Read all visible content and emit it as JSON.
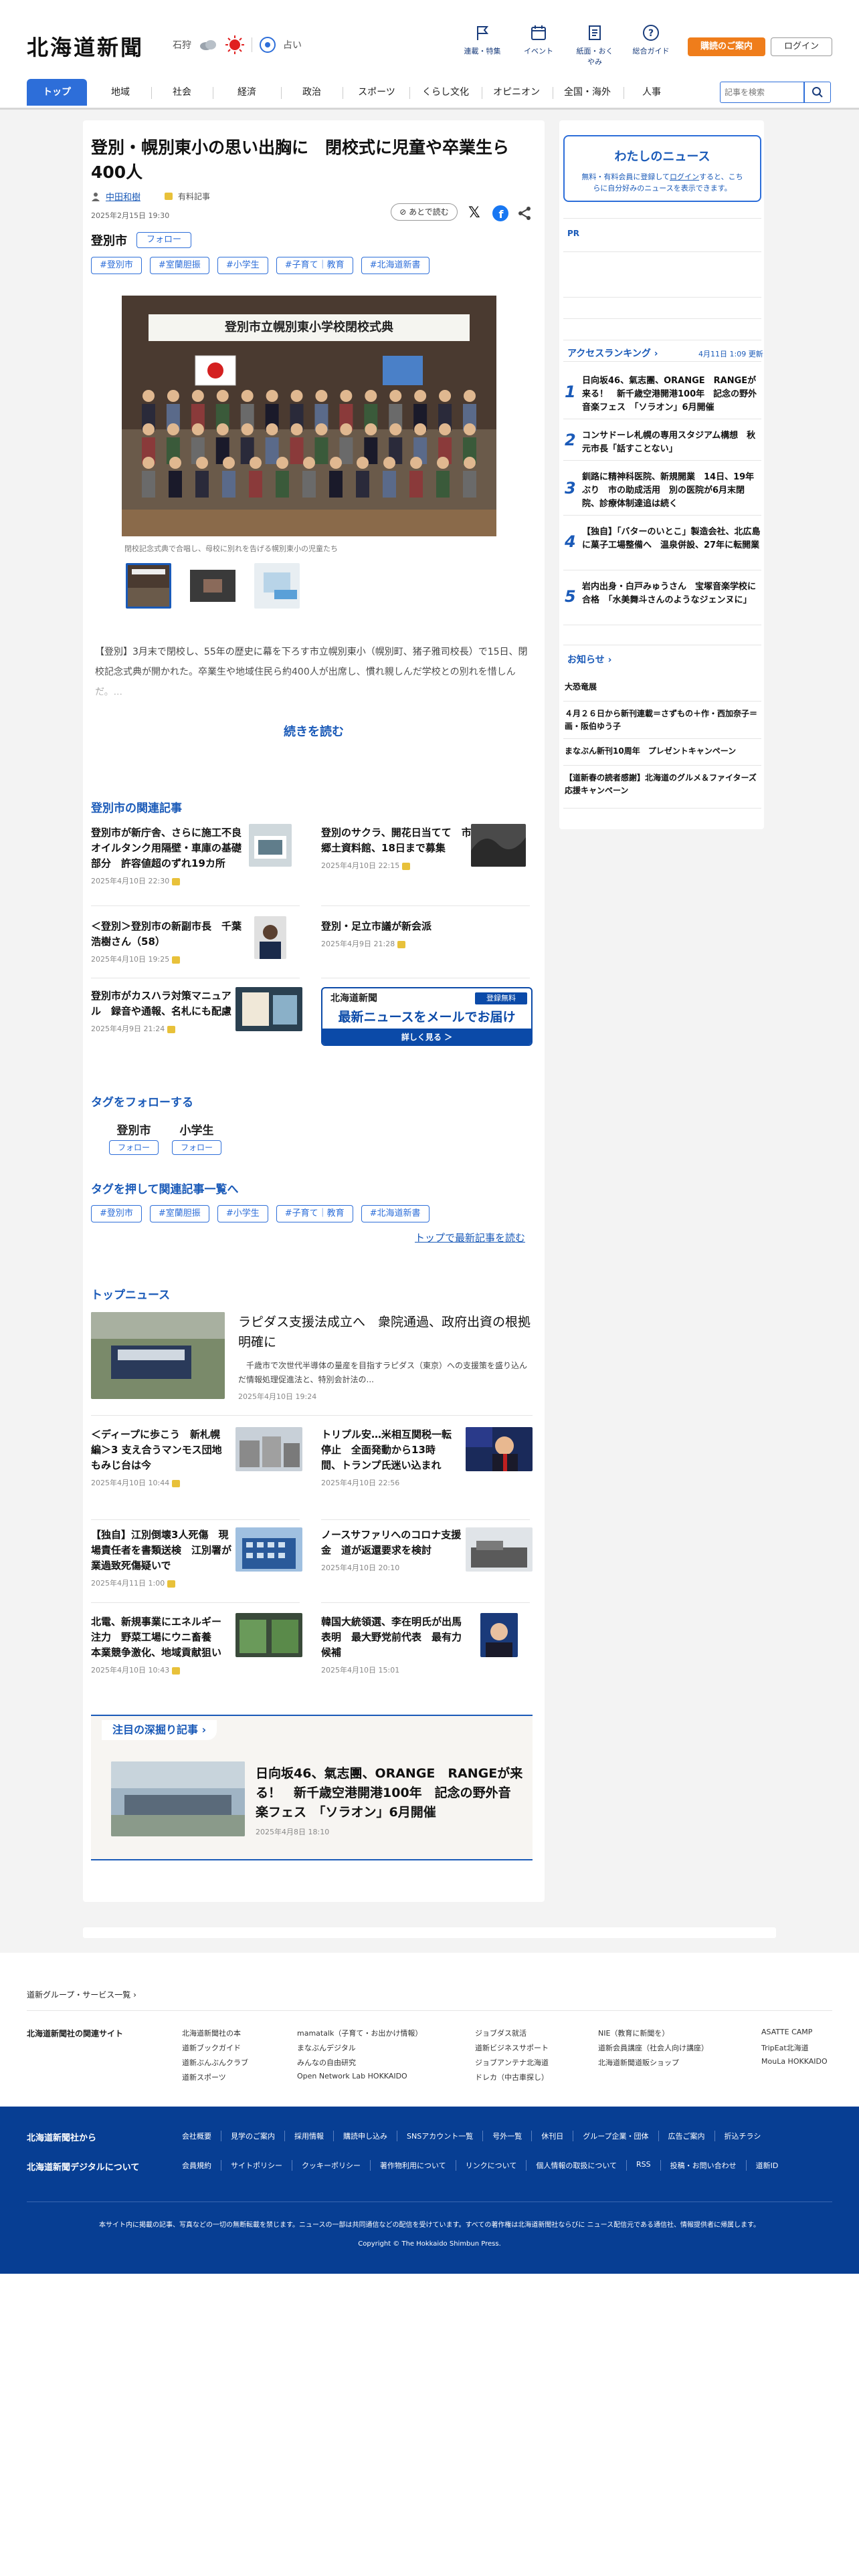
{
  "header": {
    "logo": "北海道新聞",
    "weather_city": "石狩",
    "fortune": "占い",
    "icons": [
      {
        "label": "連載・特集",
        "icon": "flag-icon"
      },
      {
        "label": "イベント",
        "icon": "calendar-icon"
      },
      {
        "label": "紙面・おくやみ",
        "icon": "newspaper-icon"
      },
      {
        "label": "総合ガイド",
        "icon": "help-icon"
      }
    ],
    "subscribe": "購読のご案内",
    "login": "ログイン"
  },
  "nav": {
    "items": [
      "トップ",
      "地域",
      "社会",
      "経済",
      "政治",
      "スポーツ",
      "くらし文化",
      "オピニオン",
      "全国・海外",
      "人事"
    ],
    "search_placeholder": "記事を検索"
  },
  "article": {
    "title": "登別・幌別東小の思い出胸に　閉校式に児童や卒業生ら400人",
    "author": "中田和樹",
    "badge": "有料記事",
    "date": "2025年2月15日 19:30",
    "save": "あとで読む",
    "location": "登別市",
    "follow": "フォロー",
    "tags": [
      "#登別市",
      "#室蘭胆振",
      "#小学生",
      "#子育て｜教育",
      "#北海道新書"
    ],
    "photo_banner": "登別市立幌別東小学校閉校式典",
    "caption": "閉校記念式典で合唱し、母校に別れを告げる幌別東小の児童たち",
    "lead": "【登別】3月末で閉校し、55年の歴史に幕を下ろす市立幌別東小（幌別町、猪子雅司校長）で15日、閉校記念式典が開かれた。卒業生や地域住民ら約400人が出席し、慣れ親しんだ学校との別れを惜しんだ。...",
    "read_more": "続きを読む"
  },
  "related": {
    "heading": "登別市の関連記事",
    "items": [
      {
        "title": "登別市が新庁舎、さらに施工不良　オイルタンク用隔壁・車庫の基礎部分　許容値超のずれ19カ所",
        "date": "2025年4月10日 22:30"
      },
      {
        "title": "登別のサクラ、開花日当てて　市郷土資料館、18日まで募集",
        "date": "2025年4月10日 22:15"
      },
      {
        "title": "＜登別＞登別市の新副市長　千葉浩樹さん（58）",
        "date": "2025年4月10日 19:25"
      },
      {
        "title": "登別・足立市議が新会派",
        "date": "2025年4月9日 21:28"
      },
      {
        "title": "登別市がカスハラ対策マニュアル　録音や通報、名札にも配慮",
        "date": "2025年4月9日 21:24"
      }
    ],
    "promo_logo": "北海道新聞",
    "promo_badge": "登録無料",
    "promo_title": "最新ニュースをメールでお届け",
    "promo_btn": "詳しく見る ＞"
  },
  "follow_tags": {
    "heading": "タグをフォローする",
    "items": [
      {
        "name": "登別市",
        "btn": "フォロー"
      },
      {
        "name": "小学生",
        "btn": "フォロー"
      }
    ]
  },
  "tag_links": {
    "heading": "タグを押して関連記事一覧へ",
    "tags": [
      "#登別市",
      "#室蘭胆振",
      "#小学生",
      "#子育て｜教育",
      "#北海道新書"
    ],
    "top_link": "トップで最新記事を読む"
  },
  "top_news": {
    "heading": "トップニュース",
    "lead": {
      "title": "ラピダス支援法成立へ　衆院通過、政府出資の根拠明確に",
      "text": "千歳市で次世代半導体の量産を目指すラピダス（東京）への支援策を盛り込んだ情報処理促進法と、特別会計法の...",
      "date": "2025年4月10日 19:24"
    },
    "items": [
      {
        "title": "＜ディープに歩こう　新札幌編＞3 支え合うマンモス団地　もみじ台は今",
        "date": "2025年4月10日 10:44"
      },
      {
        "title": "トリプル安…米相互関税一転停止　全面発動から13時間、トランプ氏迷い込まれ",
        "date": "2025年4月10日 22:56"
      },
      {
        "title": "【独自】江別倒壊3人死傷　現場責任者を書類送検　江別署が業過致死傷疑いで",
        "date": "2025年4月11日 1:00"
      },
      {
        "title": "ノースサファリへのコロナ支援金　道が返還要求を検討",
        "date": "2025年4月10日 20:10"
      },
      {
        "title": "北電、新規事業にエネルギー注力　野菜工場にウニ畜養　本業競争激化、地域貢献狙い",
        "date": "2025年4月10日 10:43"
      },
      {
        "title": "韓国大統領選、李在明氏が出馬表明　最大野党前代表　最有力候補",
        "date": "2025年4月10日 15:01"
      }
    ]
  },
  "feature": {
    "heading": "注目の深掘り記事",
    "title": "日向坂46、氣志團、ORANGE　RANGEが来る！　新千歳空港開港100年　記念の野外音楽フェス　「ソラオン」6月開催",
    "date": "2025年4月8日 18:10"
  },
  "sidebar": {
    "mynews_title": "わたしのニュース",
    "mynews_text1": "無料・有料会員に登録して",
    "mynews_link": "ログイン",
    "mynews_text2": "すると、こちらに自分好みのニュースを表示できます。",
    "pr": "PR",
    "ranking_title": "アクセスランキング",
    "ranking_date": "4月11日 1:09 更新",
    "ranking": [
      "日向坂46、氣志團、ORANGE　RANGEが来る！　新千歳空港開港100年　記念の野外音楽フェス　「ソラオン」6月開催",
      "コンサドーレ札幌の専用スタジアム構想　秋元市長「話すことない」",
      "釧路に精神科医院、新規開業　14日、19年ぶり　市の助成活用　別の医院が6月末閉院、診療体制達追は続く",
      "【独自】「バターのいとこ」製造会社、北広島に菓子工場整備へ　温泉併設、27年に転開業",
      "岩内出身・白戸みゅうさん　宝塚音楽学校に合格　「水美舞斗さんのようなジェンヌに」"
    ],
    "news_title": "お知らせ",
    "news": [
      "大恐竜展",
      "４月２６日から新刊連載＝さずもの＋作・西加奈子＝画・阪伯ゆう子",
      "まなぶん新刊10周年　プレゼントキャンペーン",
      "【道新春の読者感謝】北海道のグルメ＆ファイターズ応援キャンペーン"
    ]
  },
  "footer": {
    "group": "道新グループ・サービス一覧",
    "related_title": "北海道新聞社の関連サイト",
    "col1": [
      "北海道新聞社の本",
      "道新ブックガイド",
      "道新ぶんぶんクラブ",
      "道新スポーツ"
    ],
    "col2": [
      "mamatalk（子育て・お出かけ情報）",
      "まなぶんデジタル",
      "みんなの自由研究",
      "Open Network Lab HOKKAIDO"
    ],
    "col3": [
      "ジョブダス就活",
      "道新ビジネスサポート",
      "ジョブアンテナ北海道",
      "ドレカ（中古車探し）"
    ],
    "col4": [
      "NIE（教育に新聞を）",
      "道新会員講座（社会人向け講座）",
      "北海道新聞道販ショップ"
    ],
    "col5": [
      "ASATTE CAMP",
      "TripEat北海道",
      "MouLa HOKKAIDO"
    ],
    "blue_title1": "北海道新聞社から",
    "blue_links1": [
      "会社概要",
      "見学のご案内",
      "採用情報",
      "購読申し込み",
      "SNSアカウント一覧",
      "号外一覧",
      "休刊日",
      "グループ企業・団体",
      "広告ご案内",
      "折込チラシ"
    ],
    "blue_title2": "北海道新聞デジタルについて",
    "blue_links2": [
      "会員規約",
      "サイトポリシー",
      "クッキーポリシー",
      "著作物利用について",
      "リンクについて",
      "個人情報の取扱について",
      "RSS",
      "投稿・お問い合わせ",
      "道新ID"
    ],
    "notice": "本サイト内に掲載の記事、写真などの一切の無断転載を禁じます。ニュースの一部は共同通信などの配信を受けています。すべての著作権は北海道新聞社ならびに ニュース配信元である通信社、情報提供者に帰属します。",
    "copyright": "Copyright © The Hokkaido Shimbun Press."
  },
  "colors": {
    "accent": "#2d6ed9",
    "brand_blue": "#073e93",
    "orange": "#ef7d1b",
    "link_blue": "#1a5ab8"
  }
}
